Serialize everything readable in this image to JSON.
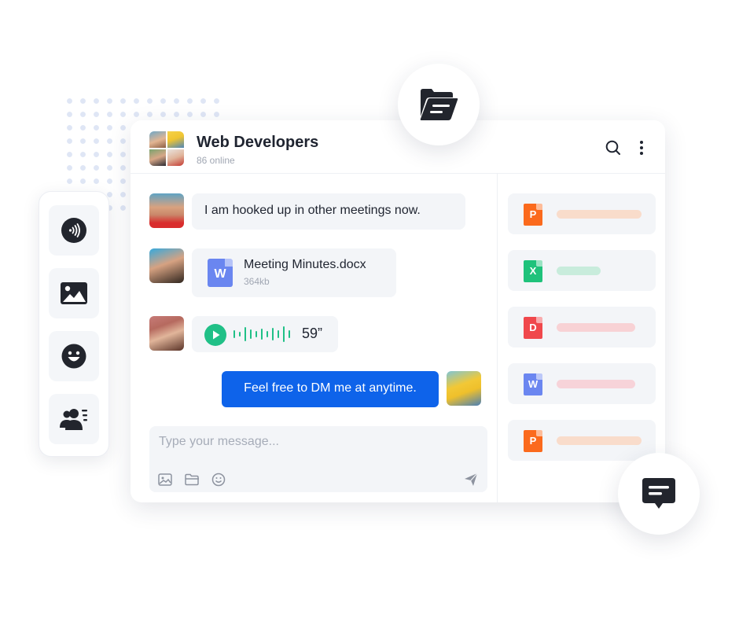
{
  "chat": {
    "title": "Web Developers",
    "online": "86 online",
    "messages": [
      {
        "text": "I am hooked up in other meetings now."
      },
      {
        "file_name": "Meeting Minutes.docx",
        "file_size": "364kb",
        "file_icon_letter": "W"
      },
      {
        "voice_duration": "59”"
      },
      {
        "text": "Feel free to DM me at anytime."
      }
    ]
  },
  "composer": {
    "placeholder": "Type your message..."
  },
  "files_panel": {
    "items": [
      {
        "letter": "P",
        "icon_color": "#fb6a1d",
        "bar_color": "#f9dccb"
      },
      {
        "letter": "X",
        "icon_color": "#1fc27b",
        "bar_color": "#c8ecdc"
      },
      {
        "letter": "D",
        "icon_color": "#f0484c",
        "bar_color": "#f8d2d5"
      },
      {
        "letter": "W",
        "icon_color": "#6b86f0",
        "bar_color": "#f7d3d9"
      },
      {
        "letter": "P",
        "icon_color": "#fb6a1d",
        "bar_color": "#f9dccb"
      }
    ]
  },
  "side_tools": {
    "items": [
      "nfc-icon",
      "image-icon",
      "emoji-icon",
      "group-icon"
    ]
  },
  "colors": {
    "accent": "#0e63ea",
    "voice_green": "#20c087",
    "dark_icon": "#22252d"
  }
}
